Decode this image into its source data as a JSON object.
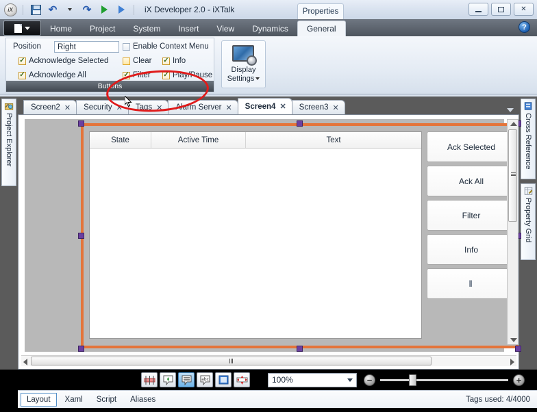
{
  "window": {
    "app_title": "iX Developer 2.0 - iXTalk",
    "contextual_tab": "Properties",
    "logo_text": "iX",
    "minimize": "minimize",
    "maximize": "maximize",
    "close": "✕",
    "help": "?"
  },
  "quick_access": [
    {
      "name": "save-icon",
      "label": "Save"
    },
    {
      "name": "undo-icon",
      "label": "↶"
    },
    {
      "name": "undo-dropdown-icon",
      "label": "▾"
    },
    {
      "name": "redo-icon",
      "label": "↷"
    },
    {
      "name": "run-icon",
      "label": "Run"
    },
    {
      "name": "run-alt-icon",
      "label": "Run Alternate"
    }
  ],
  "ribbon": {
    "app_button": "File",
    "tabs": [
      {
        "label": "Home",
        "active": false
      },
      {
        "label": "Project",
        "active": false
      },
      {
        "label": "System",
        "active": false
      },
      {
        "label": "Insert",
        "active": false
      },
      {
        "label": "View",
        "active": false
      },
      {
        "label": "Dynamics",
        "active": false
      },
      {
        "label": "General",
        "active": true
      }
    ],
    "buttons_group": {
      "caption": "Buttons",
      "position_label": "Position",
      "position_value": "Right",
      "checkboxes": [
        {
          "label": "Acknowledge Selected",
          "checked": true,
          "hover": false
        },
        {
          "label": "Acknowledge All",
          "checked": true,
          "hover": false
        },
        {
          "label": "Enable Context Menu",
          "checked": false,
          "hover": false
        },
        {
          "label": "Clear",
          "checked": false,
          "hover": true
        },
        {
          "label": "Info",
          "checked": true,
          "hover": false
        },
        {
          "label": "Filter",
          "checked": true,
          "hover": false
        },
        {
          "label": "Play/Pause",
          "checked": true,
          "hover": false
        }
      ]
    },
    "display_group": {
      "button_line1": "Display",
      "button_line2": "Settings"
    },
    "annotation": {
      "shape": "red-ellipse",
      "color": "#e01b1b"
    }
  },
  "dock_left": [
    {
      "label": "Project Explorer",
      "icon": "project-explorer-icon"
    }
  ],
  "dock_right": [
    {
      "label": "Cross Reference",
      "icon": "cross-reference-icon"
    },
    {
      "label": "Property Grid",
      "icon": "property-grid-icon"
    }
  ],
  "document_tabs": [
    {
      "label": "Screen2",
      "active": false,
      "close": "✕"
    },
    {
      "label": "Security",
      "active": false,
      "close": "✕"
    },
    {
      "label": "Tags",
      "active": false,
      "close": "✕"
    },
    {
      "label": "Alarm Server",
      "active": false,
      "close": "✕"
    },
    {
      "label": "Screen4",
      "active": true,
      "close": "✕"
    },
    {
      "label": "Screen3",
      "active": false,
      "close": "✕"
    }
  ],
  "canvas": {
    "alarm_viewer": {
      "columns": [
        "State",
        "Active Time",
        "Text"
      ],
      "rows": [],
      "buttons": [
        {
          "label": "Ack Selected",
          "name": "ack-selected-button"
        },
        {
          "label": "Ack All",
          "name": "ack-all-button"
        },
        {
          "label": "Filter",
          "name": "filter-button"
        },
        {
          "label": "Info",
          "name": "info-button"
        },
        {
          "label": "‖",
          "name": "play-pause-button"
        }
      ]
    },
    "selection_color": "#e4743a",
    "handle_color": "#6b3fa0"
  },
  "zoombar": {
    "tools": [
      {
        "name": "snap-to-grid-icon",
        "active": false
      },
      {
        "name": "snap-to-object-icon",
        "active": false
      },
      {
        "name": "show-tooltips-icon",
        "active": true
      },
      {
        "name": "show-text-icon",
        "active": false
      },
      {
        "name": "show-panel-icon",
        "active": false
      },
      {
        "name": "align-icon",
        "active": false
      }
    ],
    "zoom_value": "100%",
    "zoom_out": "−",
    "zoom_in": "+"
  },
  "statusbar": {
    "tabs": [
      {
        "label": "Layout",
        "active": true
      },
      {
        "label": "Xaml",
        "active": false
      },
      {
        "label": "Script",
        "active": false
      },
      {
        "label": "Aliases",
        "active": false
      }
    ],
    "tags_used": "Tags used: 4/4000"
  }
}
